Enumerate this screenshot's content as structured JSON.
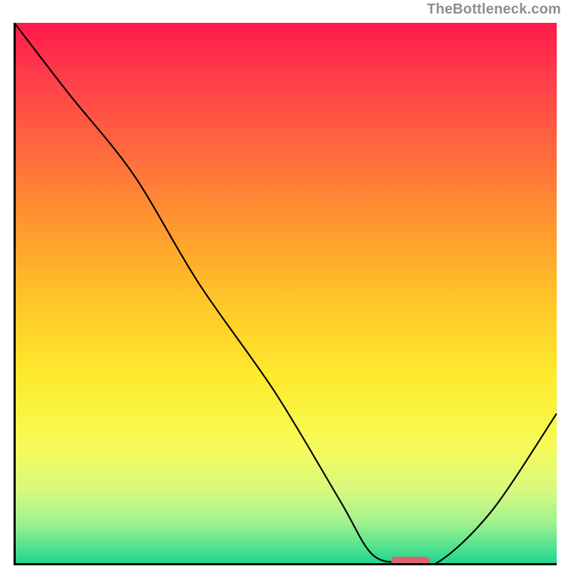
{
  "attribution": "TheBottleneck.com",
  "colors": {
    "gradient_top": "#ff1a4b",
    "gradient_bottom": "#17d48f",
    "curve": "#000000",
    "marker": "#e06070",
    "axis": "#000000",
    "attribution_text": "#8e8e8e"
  },
  "chart_data": {
    "type": "line",
    "title": "",
    "xlabel": "",
    "ylabel": "",
    "xlim": [
      0,
      100
    ],
    "ylim": [
      0,
      100
    ],
    "grid": false,
    "series": [
      {
        "name": "bottleneck-curve",
        "x": [
          0,
          10,
          22,
          34,
          48,
          60,
          66,
          72,
          78,
          88,
          100
        ],
        "values": [
          100,
          87,
          72,
          52,
          32,
          12,
          2,
          0.5,
          0.5,
          10,
          28
        ]
      }
    ],
    "optimal_marker": {
      "x_start": 70,
      "x_end": 76,
      "y": 0.8
    },
    "legend": false
  }
}
